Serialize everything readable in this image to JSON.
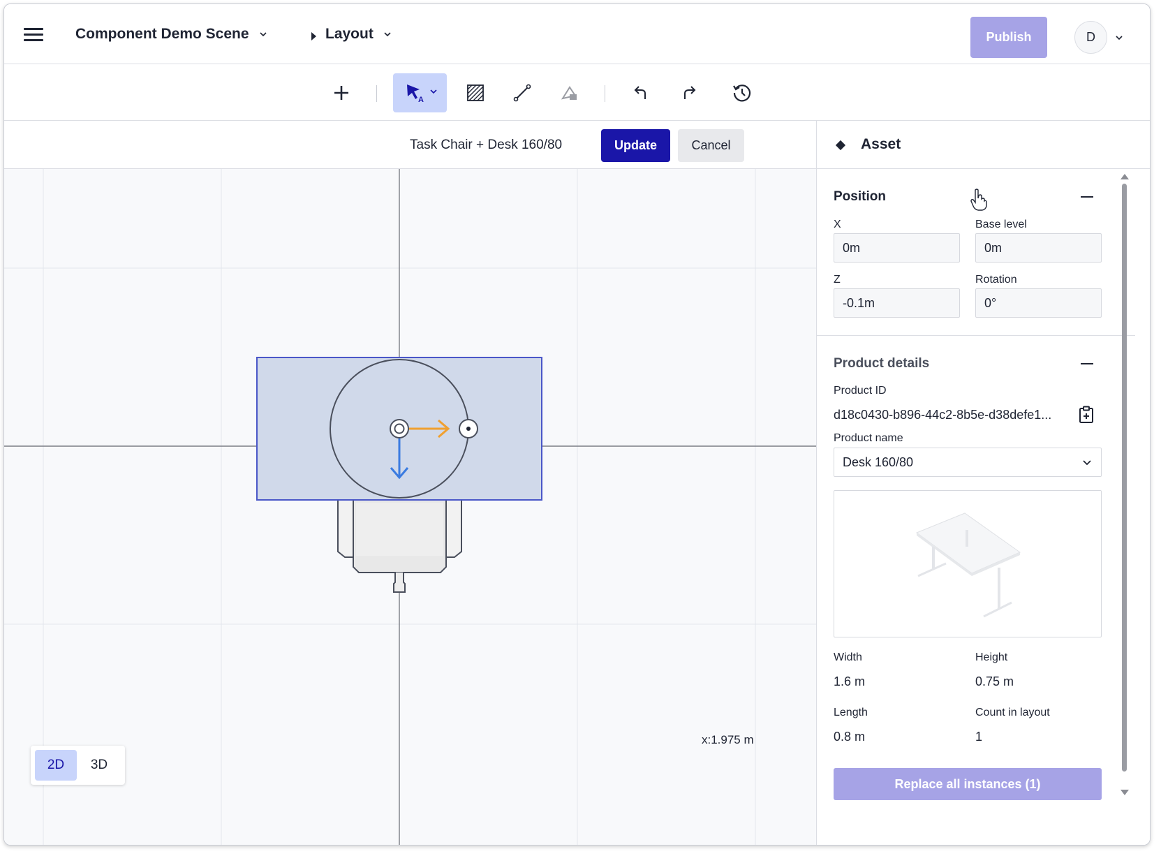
{
  "header": {
    "scene_name": "Component Demo Scene",
    "section_name": "Layout",
    "publish_label": "Publish",
    "avatar_initial": "D"
  },
  "toolbar": {
    "tools": [
      "add-icon",
      "select-tool-icon",
      "hatch-area-icon",
      "line-draw-icon",
      "paint-bucket-icon",
      "undo-icon",
      "redo-icon",
      "history-icon"
    ],
    "active_tool": "select-tool-icon"
  },
  "edit_bar": {
    "label": "Task Chair + Desk 160/80",
    "update_label": "Update",
    "cancel_label": "Cancel"
  },
  "canvas": {
    "coord_readout": "x:1.975 m",
    "view_2d_label": "2D",
    "view_3d_label": "3D",
    "active_view": "2D",
    "colors": {
      "selection_fill": "#d0d9ea",
      "selection_stroke": "#4a57c8",
      "axis_x": "#f0a030",
      "axis_z": "#3a7be0"
    }
  },
  "panel": {
    "title": "Asset",
    "position": {
      "title": "Position",
      "x_label": "X",
      "x_value": "0m",
      "base_level_label": "Base level",
      "base_level_value": "0m",
      "z_label": "Z",
      "z_value": "-0.1m",
      "rotation_label": "Rotation",
      "rotation_value": "0°"
    },
    "product": {
      "title": "Product details",
      "id_label": "Product ID",
      "id_value": "d18c0430-b896-44c2-8b5e-d38defe1...",
      "name_label": "Product name",
      "name_value": "Desk 160/80",
      "width_label": "Width",
      "width_value": "1.6 m",
      "height_label": "Height",
      "height_value": "0.75 m",
      "length_label": "Length",
      "length_value": "0.8 m",
      "count_label": "Count in layout",
      "count_value": "1"
    },
    "replace_label": "Replace all instances (1)"
  },
  "colors": {
    "primary": "#1a16a8",
    "primary_disabled": "#a6a3e6",
    "active_tool_bg": "#c8d4fb"
  }
}
